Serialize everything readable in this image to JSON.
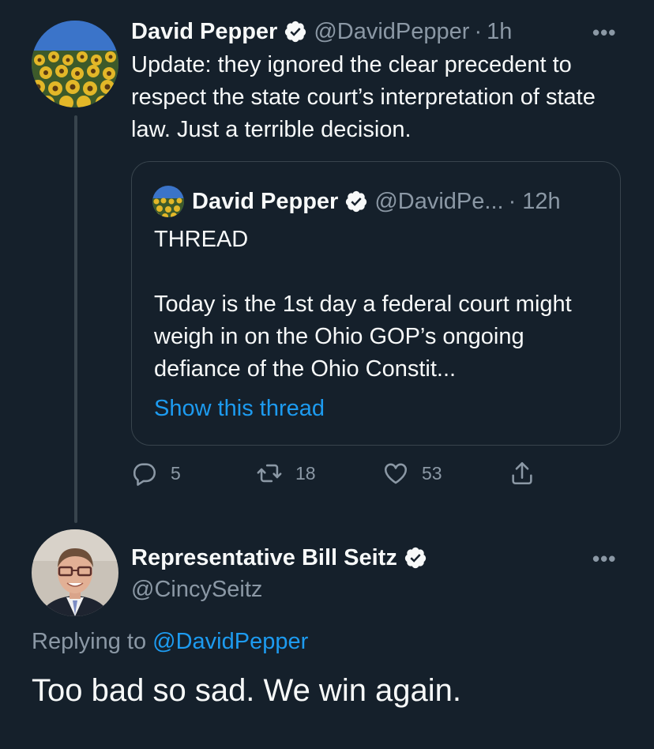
{
  "colors": {
    "background": "#15202b",
    "text": "#f7f9f9",
    "secondary": "#8b98a5",
    "accent": "#1d9bf0",
    "border": "#38444d"
  },
  "tweet1": {
    "author_name": "David Pepper",
    "handle": "@DavidPepper",
    "separator": "·",
    "time": "1h",
    "more_label": "•••",
    "text": "Update: they ignored the clear precedent to respect the state court’s interpretation of state law. Just a terrible decision.",
    "quote": {
      "author_name": "David Pepper",
      "handle": "@DavidPe...",
      "time": "· 12h",
      "text_line1": "THREAD",
      "text_body": "Today is the 1st day a federal court might weigh in on the Ohio GOP’s ongoing defiance of the Ohio Constit...",
      "show_thread": "Show this thread"
    },
    "actions": {
      "replies": "5",
      "retweets": "18",
      "likes": "53"
    }
  },
  "tweet2": {
    "author_name": "Representative Bill Seitz",
    "handle": "@CincySeitz",
    "more_label": "•••",
    "replying_prefix": "Replying to",
    "replying_to": "@DavidPepper",
    "text": "Too bad so sad. We win again."
  },
  "icons": {
    "verified": "verified-badge-icon",
    "reply": "reply-icon",
    "retweet": "retweet-icon",
    "like": "heart-icon",
    "share": "share-icon",
    "more": "more-icon"
  }
}
